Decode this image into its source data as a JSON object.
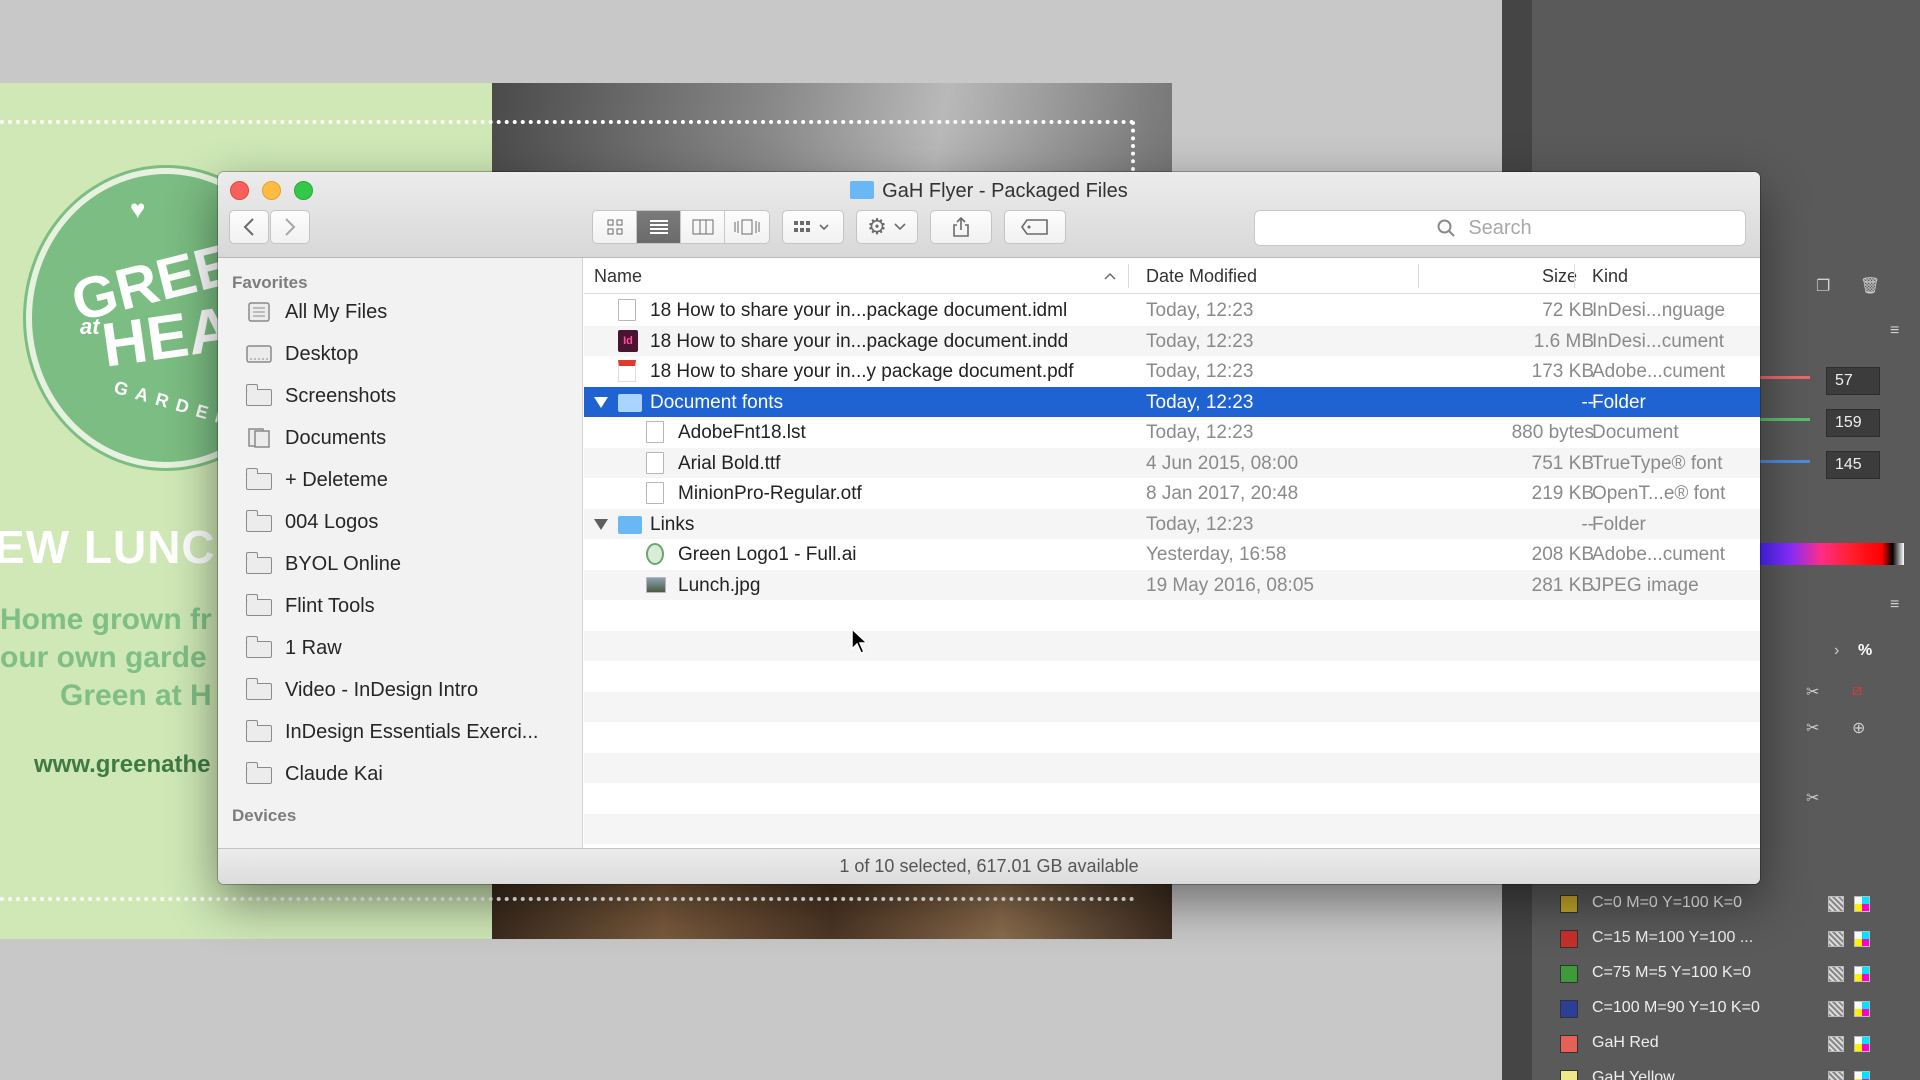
{
  "finder": {
    "title": "GaH Flyer - Packaged Files",
    "search_placeholder": "Search",
    "sidebar": {
      "favorites_heading": "Favorites",
      "devices_heading": "Devices",
      "items": [
        {
          "label": "All My Files",
          "icon": "all-files-icon"
        },
        {
          "label": "Desktop",
          "icon": "desktop-icon"
        },
        {
          "label": "Screenshots",
          "icon": "folder-icon"
        },
        {
          "label": "Documents",
          "icon": "documents-icon"
        },
        {
          "label": "+ Deleteme",
          "icon": "folder-icon"
        },
        {
          "label": "004 Logos",
          "icon": "folder-icon"
        },
        {
          "label": "BYOL Online",
          "icon": "folder-icon"
        },
        {
          "label": "Flint Tools",
          "icon": "folder-icon"
        },
        {
          "label": "1 Raw",
          "icon": "folder-icon"
        },
        {
          "label": "Video - InDesign Intro",
          "icon": "folder-icon"
        },
        {
          "label": "InDesign Essentials Exerci...",
          "icon": "folder-icon"
        },
        {
          "label": "Claude Kai",
          "icon": "folder-icon"
        }
      ]
    },
    "columns": {
      "name": "Name",
      "date": "Date Modified",
      "size": "Size",
      "kind": "Kind"
    },
    "rows": [
      {
        "name": "18 How to share your in...package document.idml",
        "date": "Today, 12:23",
        "size": "72 KB",
        "kind": "InDesi...nguage",
        "icon": "idml-file-icon",
        "indent": 0,
        "selected": false,
        "expanded": null
      },
      {
        "name": "18 How to share your in...package document.indd",
        "date": "Today, 12:23",
        "size": "1.6 MB",
        "kind": "InDesi...cument",
        "icon": "indesign-file-icon",
        "indent": 0,
        "selected": false,
        "expanded": null
      },
      {
        "name": "18 How to share your in...y package document.pdf",
        "date": "Today, 12:23",
        "size": "173 KB",
        "kind": "Adobe...cument",
        "icon": "pdf-file-icon",
        "indent": 0,
        "selected": false,
        "expanded": null
      },
      {
        "name": "Document fonts",
        "date": "Today, 12:23",
        "size": "--",
        "kind": "Folder",
        "icon": "folder-icon",
        "indent": 0,
        "selected": true,
        "expanded": true
      },
      {
        "name": "AdobeFnt18.lst",
        "date": "Today, 12:23",
        "size": "880 bytes",
        "kind": "Document",
        "icon": "document-icon",
        "indent": 1,
        "selected": false,
        "expanded": null
      },
      {
        "name": "Arial Bold.ttf",
        "date": "4 Jun 2015, 08:00",
        "size": "751 KB",
        "kind": "TrueType® font",
        "icon": "font-file-icon",
        "indent": 1,
        "selected": false,
        "expanded": null
      },
      {
        "name": "MinionPro-Regular.otf",
        "date": "8 Jan 2017, 20:48",
        "size": "219 KB",
        "kind": "OpenT...e® font",
        "icon": "font-file-icon",
        "indent": 1,
        "selected": false,
        "expanded": null
      },
      {
        "name": "Links",
        "date": "Today, 12:23",
        "size": "--",
        "kind": "Folder",
        "icon": "folder-icon",
        "indent": 0,
        "selected": false,
        "expanded": true
      },
      {
        "name": "Green Logo1 - Full.ai",
        "date": "Yesterday, 16:58",
        "size": "208 KB",
        "kind": "Adobe...cument",
        "icon": "illustrator-file-icon",
        "indent": 1,
        "selected": false,
        "expanded": null
      },
      {
        "name": "Lunch.jpg",
        "date": "19 May 2016, 08:05",
        "size": "281 KB",
        "kind": "JPEG image",
        "icon": "image-file-icon",
        "indent": 1,
        "selected": false,
        "expanded": null
      }
    ],
    "status": "1 of 10 selected, 617.01 GB available",
    "colors": {
      "selection": "#1f63d2",
      "folder": "#6ab7f5"
    }
  },
  "flyer": {
    "logo_top": "GREEN",
    "logo_at": "at",
    "logo_bottom": "HEA",
    "logo_ring": "GARDEN",
    "headline": "EW LUNCH",
    "line1": "Home grown fr",
    "line2": "our own garde",
    "line3": "Green at H",
    "url": "www.greenathe",
    "colors": {
      "green_bg": "#cfe8b6",
      "logo_green": "#7bbd82",
      "text_green": "#7fbf86",
      "url_green": "#3f7a45"
    }
  },
  "indesign_panel": {
    "rgb_values": [
      "57",
      "159",
      "145"
    ],
    "percent_symbol": "%",
    "swatches": [
      {
        "label": "C=0 M=0 Y=100 K=0",
        "color": "#c8a82a"
      },
      {
        "label": "C=15 M=100 Y=100 ...",
        "color": "#c7302c"
      },
      {
        "label": "C=75 M=5 Y=100 K=0",
        "color": "#3f9b3a"
      },
      {
        "label": "C=100 M=90 Y=10 K=0",
        "color": "#2a3f95"
      },
      {
        "label": "GaH Red",
        "color": "#e6605a"
      },
      {
        "label": "GaH Yellow",
        "color": "#efe88a"
      }
    ]
  }
}
